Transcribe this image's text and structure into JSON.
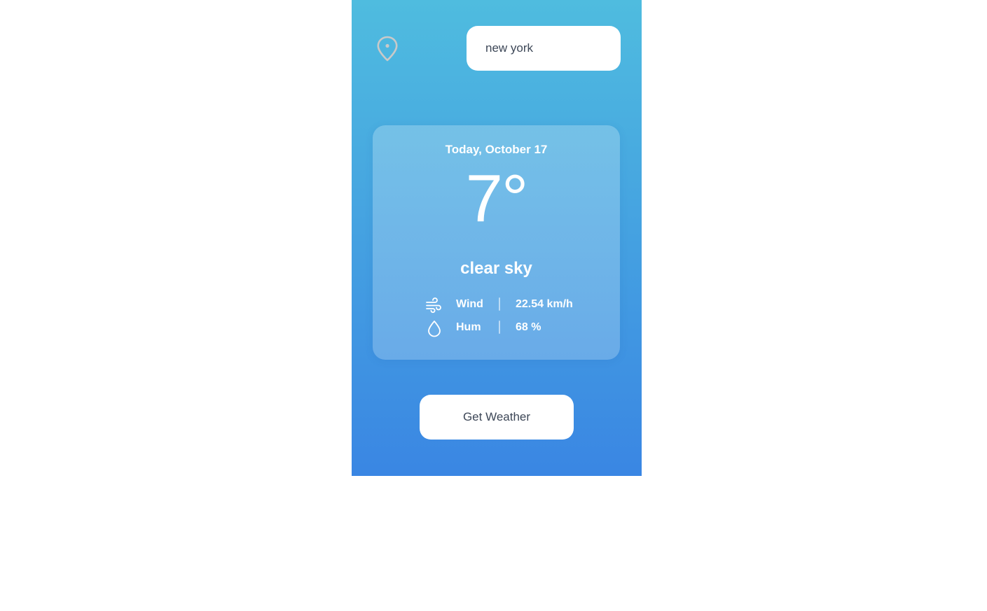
{
  "location": {
    "icon": "location-pin-icon"
  },
  "search": {
    "value": "new york",
    "placeholder": ""
  },
  "weather": {
    "date": "Today, October 17",
    "temperature": "7°",
    "description": "clear sky",
    "details": [
      {
        "icon": "wind-icon",
        "label": "Wind",
        "value": "22.54 km/h"
      },
      {
        "icon": "droplet-icon",
        "label": "Hum",
        "value": "68 %"
      }
    ]
  },
  "actions": {
    "get_weather_label": "Get Weather"
  },
  "colors": {
    "gradient_top": "#4fbcdf",
    "gradient_bottom": "#3a86e3",
    "text_dark": "#3d4757"
  }
}
